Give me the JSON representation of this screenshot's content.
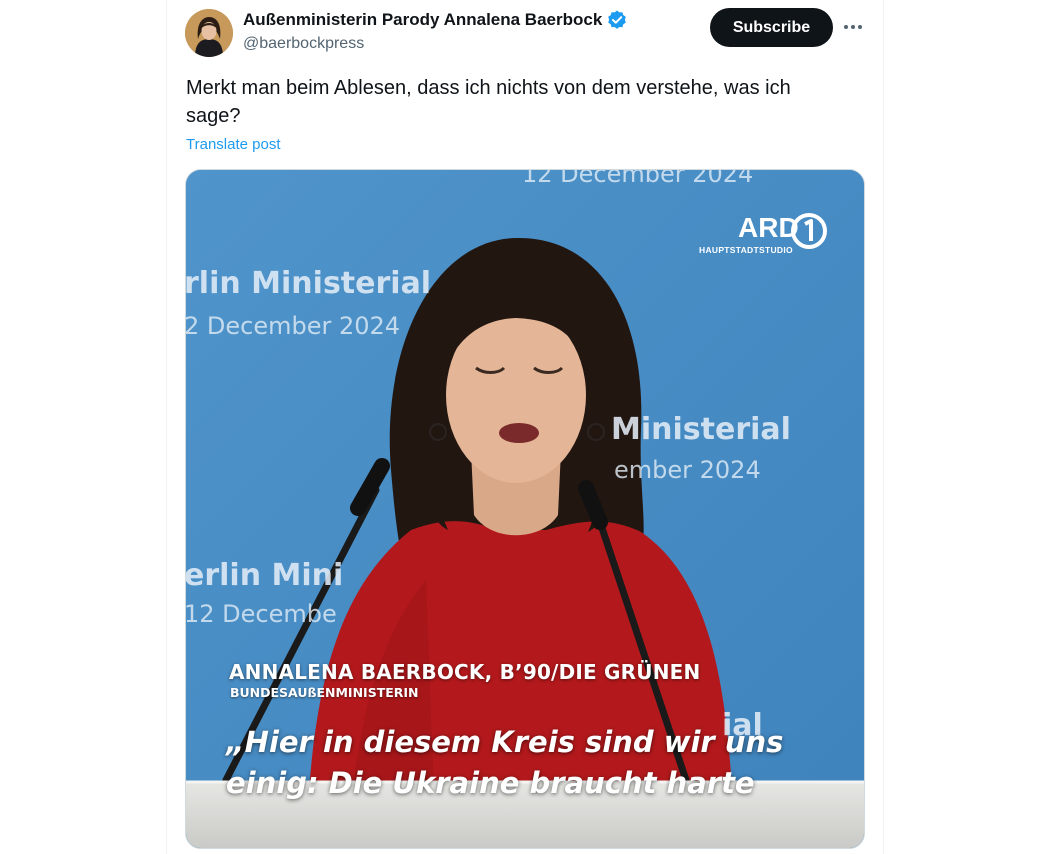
{
  "author": {
    "display_name": "Außenministerin Parody Annalena Baerbock",
    "handle": "@baerbockpress",
    "verified": true
  },
  "actions": {
    "subscribe_label": "Subscribe",
    "more_icon": "more-horizontal-icon"
  },
  "post": {
    "text": "Merkt man beim Ablesen, dass ich nichts von dem verstehe, was ich sage?",
    "translate_label": "Translate post"
  },
  "video": {
    "background_texts": [
      "12 December 2024",
      "rlin Ministerial",
      "2 December 2024",
      "Ministerial",
      "ember 2024",
      "erlin Mini",
      "12 Decembe",
      "ial"
    ],
    "broadcaster": {
      "logo_text": "ARD",
      "logo_sub": "HAUPTSTADTSTUDIO"
    },
    "lower_third": {
      "name": "ANNALENA BAERBOCK, B’90/DIE GRÜNEN",
      "title": "BUNDESAUßENMINISTERIN"
    },
    "subtitle_lines": [
      "„Hier in diesem Kreis sind wir uns",
      "einig: Die Ukraine braucht harte"
    ]
  },
  "colors": {
    "accent": "#1d9bf0",
    "button_bg": "#0f1419",
    "backdrop_blue": "#4a8fc6",
    "dress_red": "#b3191c"
  }
}
